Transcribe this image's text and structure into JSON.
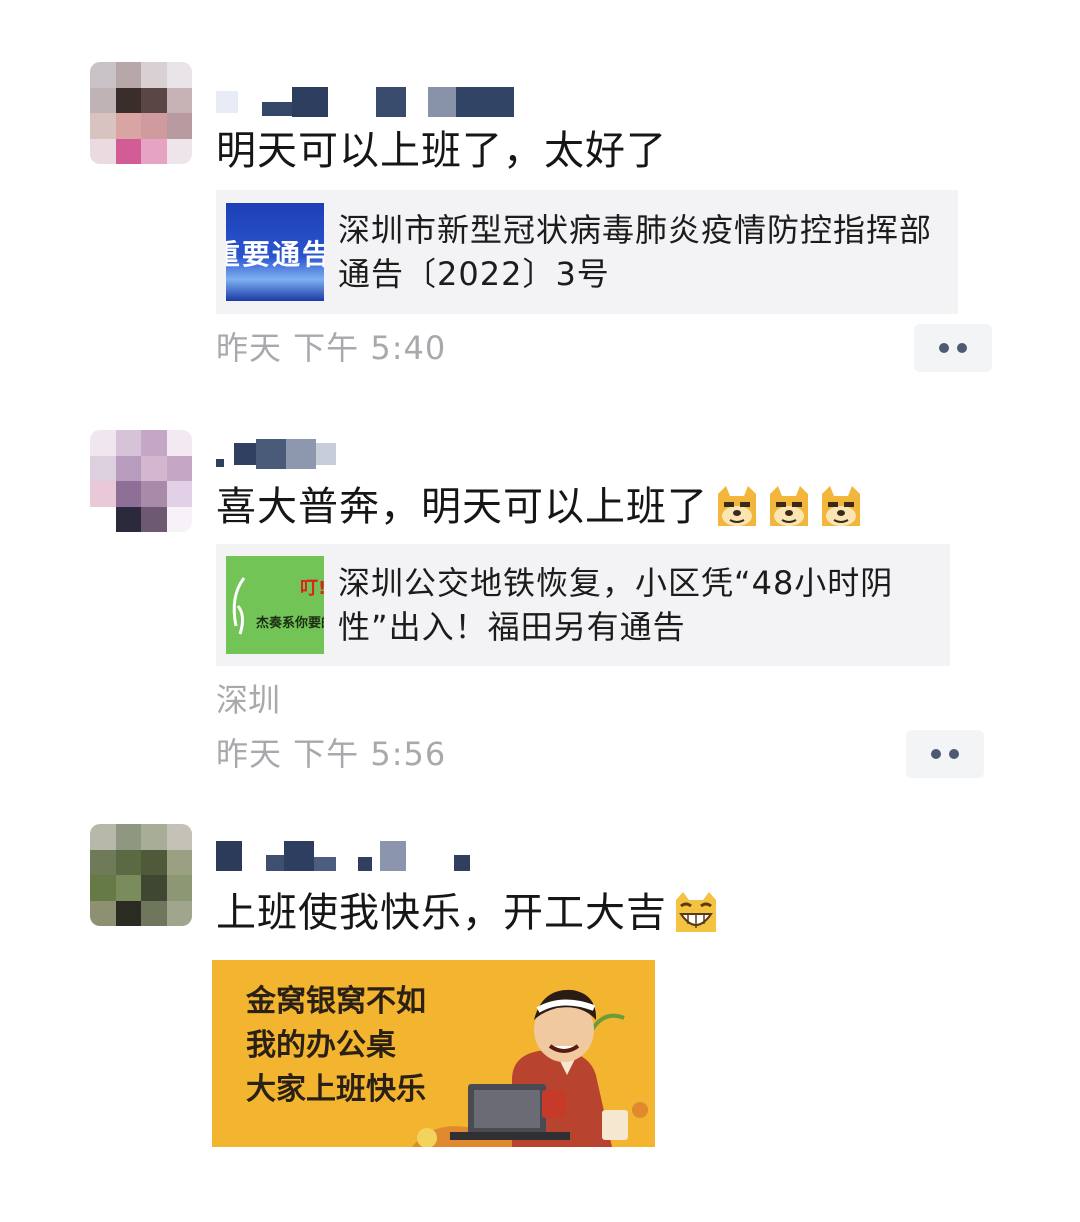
{
  "posts": [
    {
      "text": "明天可以上班了，太好了",
      "link_title": "深圳市新型冠状病毒肺炎疫情防控指挥部通告〔2022〕3号",
      "link_thumb_text": "重要通告",
      "time": "昨天 下午 5:40"
    },
    {
      "text": "喜大普奔，明天可以上班了",
      "emoji_icons": [
        "doge-icon",
        "doge-icon",
        "doge-icon"
      ],
      "link_title": "深圳公交地铁恢复，小区凭“48小时阴性”出入！福田另有通告",
      "link_thumb_text_1": "叮!",
      "link_thumb_text_2": "杰奏系你要的",
      "location": "深圳",
      "time": "昨天 下午 5:56"
    },
    {
      "text": "上班使我快乐，开工大吉",
      "emoji_icons": [
        "grin-icon"
      ],
      "banner_lines": [
        "金窝银窝不如",
        "我的办公桌",
        "大家上班快乐"
      ]
    }
  ],
  "colors": {
    "meta_gray": "#a9a9ad",
    "card_bg": "#f3f3f5",
    "more_dots": "#4d5a72",
    "banner_bg": "#f3b52f",
    "thumb_green": "#72c457",
    "thumb_blue": "#1d3fb5"
  }
}
